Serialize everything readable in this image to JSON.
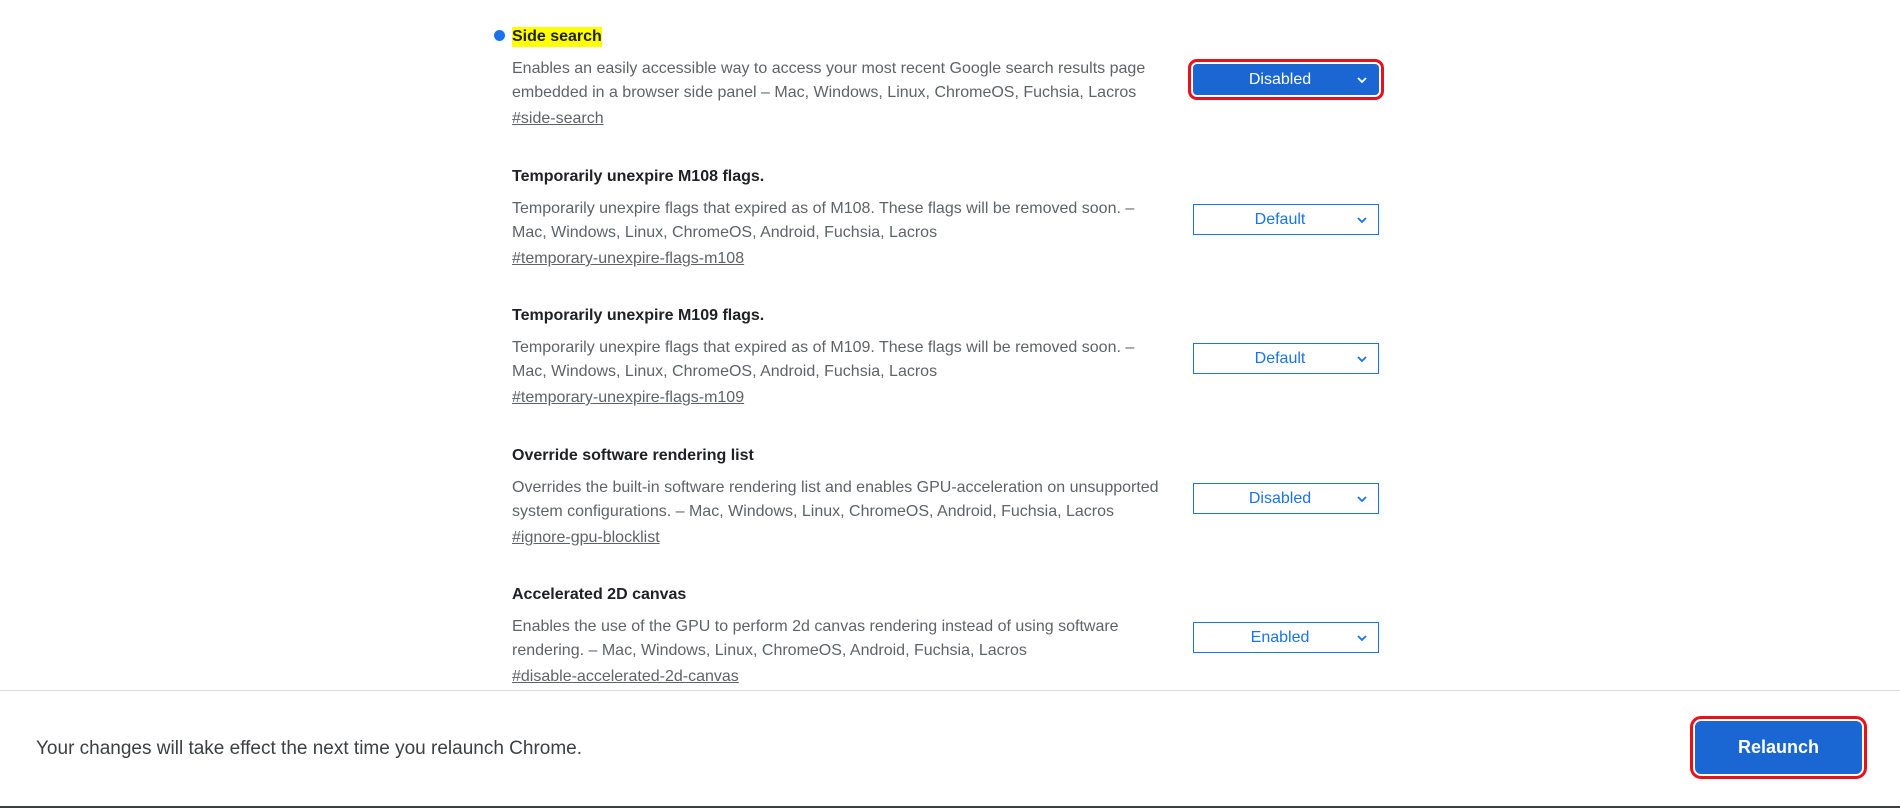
{
  "flags": [
    {
      "title": "Side search",
      "description": "Enables an easily accessible way to access your most recent Google search results page embedded in a browser side panel – Mac, Windows, Linux, ChromeOS, Fuchsia, Lacros",
      "link": "#side-search",
      "value": "Disabled"
    },
    {
      "title": "Temporarily unexpire M108 flags.",
      "description": "Temporarily unexpire flags that expired as of M108. These flags will be removed soon. – Mac, Windows, Linux, ChromeOS, Android, Fuchsia, Lacros",
      "link": "#temporary-unexpire-flags-m108",
      "value": "Default"
    },
    {
      "title": "Temporarily unexpire M109 flags.",
      "description": "Temporarily unexpire flags that expired as of M109. These flags will be removed soon. – Mac, Windows, Linux, ChromeOS, Android, Fuchsia, Lacros",
      "link": "#temporary-unexpire-flags-m109",
      "value": "Default"
    },
    {
      "title": "Override software rendering list",
      "description": "Overrides the built-in software rendering list and enables GPU-acceleration on unsupported system configurations. – Mac, Windows, Linux, ChromeOS, Android, Fuchsia, Lacros",
      "link": "#ignore-gpu-blocklist",
      "value": "Disabled"
    },
    {
      "title": "Accelerated 2D canvas",
      "description": "Enables the use of the GPU to perform 2d canvas rendering instead of using software rendering. – Mac, Windows, Linux, ChromeOS, Android, Fuchsia, Lacros",
      "link": "#disable-accelerated-2d-canvas",
      "value": "Enabled"
    }
  ],
  "bottom_bar": {
    "message": "Your changes will take effect the next time you relaunch Chrome.",
    "relaunch_label": "Relaunch"
  },
  "colors": {
    "accent": "#1a73e8",
    "active_fill": "#1a66d2",
    "annotation_outline": "#e8121b",
    "search_highlight": "#ffff00"
  }
}
